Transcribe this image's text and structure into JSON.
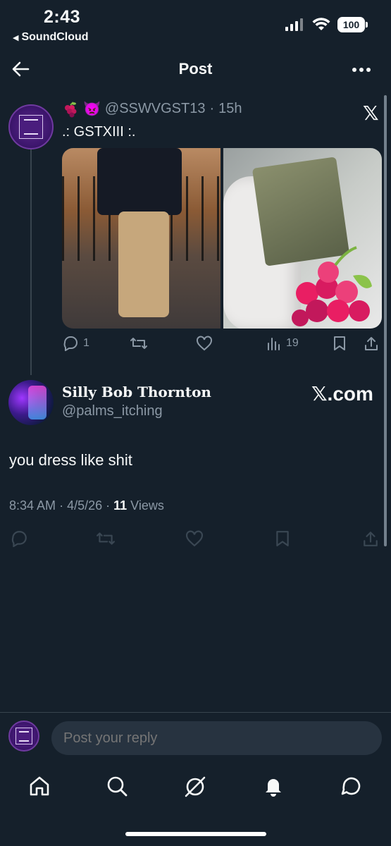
{
  "status_bar": {
    "time": "2:43",
    "back_app": "SoundCloud",
    "battery": "100"
  },
  "nav": {
    "title": "Post"
  },
  "post": {
    "emoji": "👿",
    "handle": "@SSWVGST13",
    "time": "15h",
    "text": ".: GSTXIII :.",
    "replies": "1",
    "views": "19"
  },
  "reply": {
    "name": "Silly Bob Thornton",
    "handle": "@palms_itching",
    "source": "𝕏.com",
    "text": "you dress like shit",
    "time": "8:34 AM",
    "date": "4/5/26",
    "views_count": "11",
    "views_label": "Views"
  },
  "composer": {
    "placeholder": "Post your reply"
  },
  "colors": {
    "background": "#15202b",
    "muted": "#8b98a5",
    "input_bg": "#273340"
  }
}
